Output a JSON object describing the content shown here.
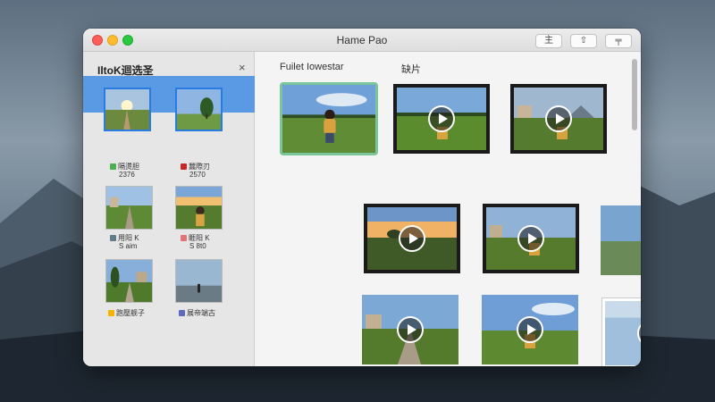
{
  "window": {
    "title": "Hame Pao",
    "toolbar": {
      "btn1": "主",
      "btn2": "⇧",
      "btn3": "╤"
    }
  },
  "sidebar": {
    "header": "IltoK迴选圣",
    "close": "×",
    "items": [
      {
        "line1": "隔燙胆",
        "line2": "2376",
        "icon_color": "#4caf50"
      },
      {
        "line1": "蠶際刃",
        "line2": "2570",
        "icon_color": "#c62828"
      },
      {
        "line1": "用阳 K",
        "line2": "S aim",
        "icon_color": "#607d8b"
      },
      {
        "line1": "睚阳 K",
        "line2": "S 8t0",
        "icon_color": "#e57373"
      },
      {
        "line1": "跑壓舰子",
        "line2": "",
        "icon_color": "#f4b400"
      },
      {
        "line1": "展帝端古",
        "line2": "",
        "icon_color": "#5c6bc0"
      }
    ]
  },
  "main": {
    "heading_left": "Fuilet Iowestar",
    "heading_right": "缺片"
  },
  "icons": [
    "close-icon",
    "play-icon",
    "share-icon"
  ]
}
